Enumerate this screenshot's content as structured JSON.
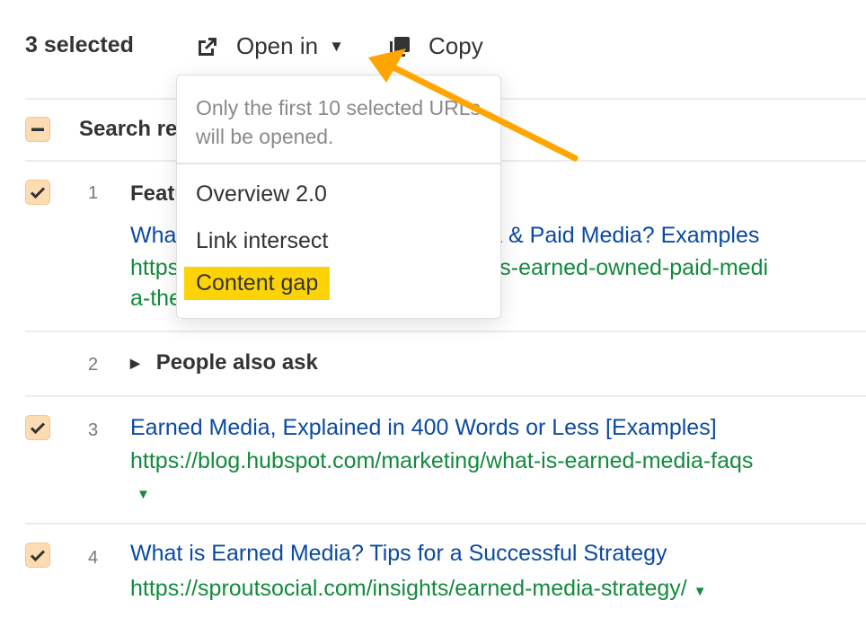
{
  "toolbar": {
    "selected_label": "3 selected",
    "open_in_label": "Open in",
    "copy_label": "Copy"
  },
  "dropdown": {
    "note": "Only the first 10 selected URLs will be opened.",
    "items": [
      {
        "label": "Overview 2.0",
        "active": false
      },
      {
        "label": "Link intersect",
        "active": false
      },
      {
        "label": "Content gap",
        "active": true
      }
    ]
  },
  "table": {
    "header_title": "Search results",
    "header_checkbox_state": "indeterminate",
    "rows": [
      {
        "num": "1",
        "type": "Featured snippet",
        "checked": true,
        "title": "What is Earned Media, Owned Media & Paid Media? Examples",
        "url_line1": "https://www.example.com/blog/what-is-earned-owned-paid-medi",
        "url_line2": "a-the"
      },
      {
        "num": "2",
        "type": "People also ask",
        "checked": false
      },
      {
        "num": "3",
        "checked": true,
        "title": "Earned Media, Explained in 400 Words or Less [Examples]",
        "url": "https://blog.hubspot.com/marketing/what-is-earned-media-faqs"
      },
      {
        "num": "4",
        "checked": true,
        "title": "What is Earned Media? Tips for a Successful Strategy",
        "url": "https://sproutsocial.com/insights/earned-media-strategy/"
      }
    ]
  },
  "colors": {
    "link": "#0b4aa2",
    "url": "#138a3e",
    "checkbox_bg": "#fddcb3",
    "highlight": "#fcd406",
    "annotation_arrow": "#ffa500"
  }
}
